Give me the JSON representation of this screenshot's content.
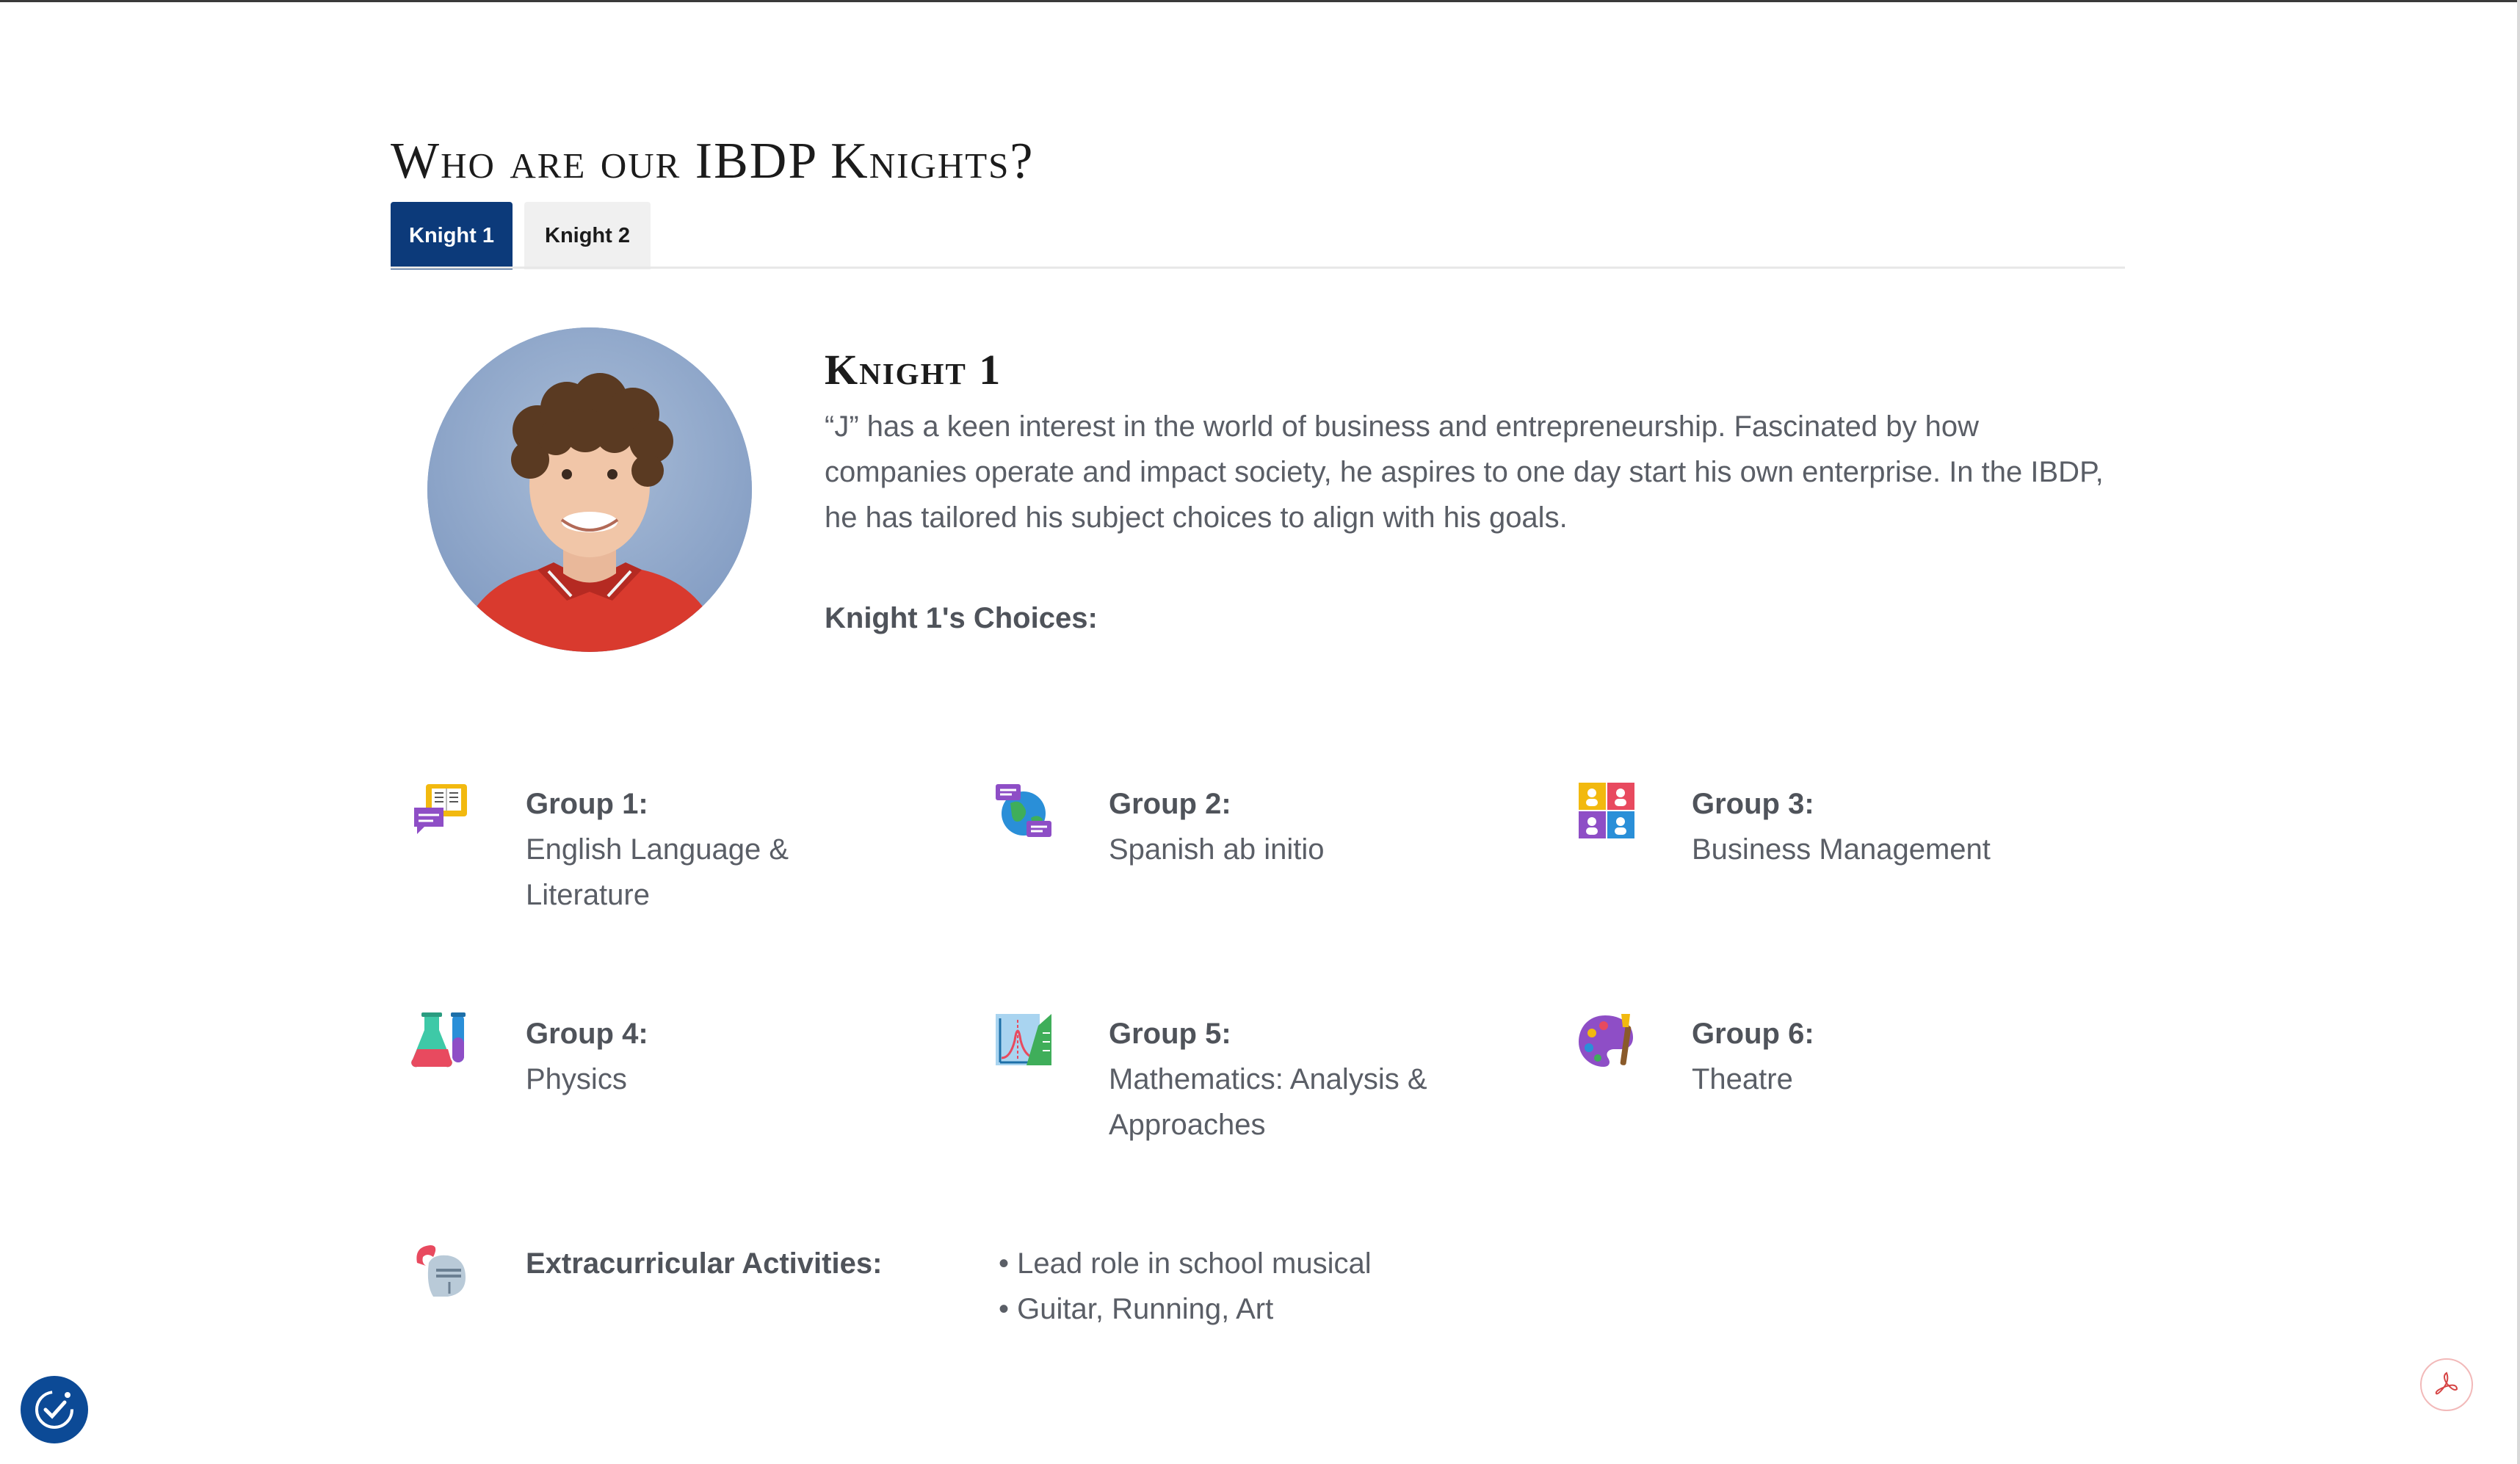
{
  "page": {
    "title": "Who are our IBDP Knights?"
  },
  "tabs": [
    {
      "label": "Knight 1",
      "active": true
    },
    {
      "label": "Knight 2",
      "active": false
    }
  ],
  "profile": {
    "heading": "Knight 1",
    "bio": "“J” has a keen interest in the world of business and entrepreneurship. Fascinated by how companies operate and impact society, he aspires to one day start his own enterprise. In the IBDP, he has tailored his subject choices to align with his goals.",
    "choices_label": "Knight 1's Choices:"
  },
  "groups": [
    {
      "title": "Group 1:",
      "value": "English Language & Literature",
      "icon": "language-literature-icon"
    },
    {
      "title": "Group 2:",
      "value": "Spanish ab initio",
      "icon": "globe-language-icon"
    },
    {
      "title": "Group 3:",
      "value": "Business Management",
      "icon": "people-grid-icon"
    },
    {
      "title": "Group 4:",
      "value": "Physics",
      "icon": "science-flask-icon"
    },
    {
      "title": "Group 5:",
      "value": "Mathematics: Analysis & Approaches",
      "icon": "math-graph-icon"
    },
    {
      "title": "Group 6:",
      "value": "Theatre",
      "icon": "paint-palette-icon"
    }
  ],
  "extracurricular": {
    "label": "Extracurricular Activities:",
    "items": [
      "Lead role in school musical",
      "Guitar, Running, Art"
    ],
    "icon": "knight-helmet-icon"
  },
  "colors": {
    "accent": "#0c3a7a",
    "tab_inactive": "#f0f0f0",
    "text": "#5a5e66"
  }
}
